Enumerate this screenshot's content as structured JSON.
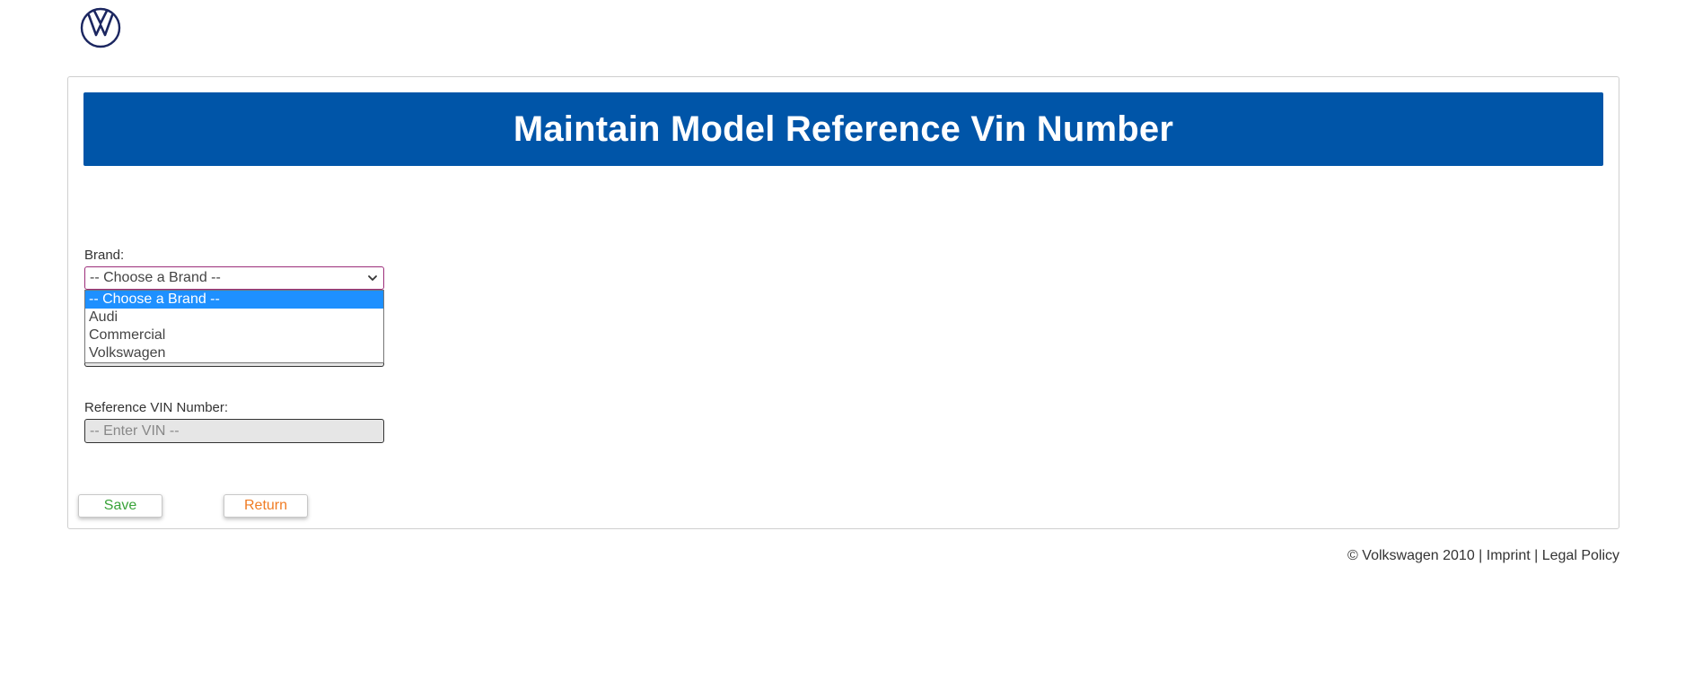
{
  "brand": {
    "logo_icon": "volkswagen-logo-icon",
    "logo_color": "#1b2660"
  },
  "page": {
    "title": "Maintain Model Reference Vin Number",
    "title_bar_color": "#0055a8"
  },
  "form": {
    "brand_label": "Brand:",
    "brand_selected": "-- Choose a Brand --",
    "brand_options": [
      "-- Choose a Brand --",
      "Audi",
      "Commercial",
      "Volkswagen"
    ],
    "vin_label": "Reference VIN Number:",
    "vin_placeholder": "-- Enter VIN --",
    "vin_value": ""
  },
  "actions": {
    "save_label": "Save",
    "save_color": "#3aa33a",
    "return_label": "Return",
    "return_color": "#f07c24"
  },
  "footer": {
    "copyright": "© Volkswagen 2010",
    "separator": " | ",
    "imprint": "Imprint",
    "legal_policy": "Legal Policy"
  }
}
